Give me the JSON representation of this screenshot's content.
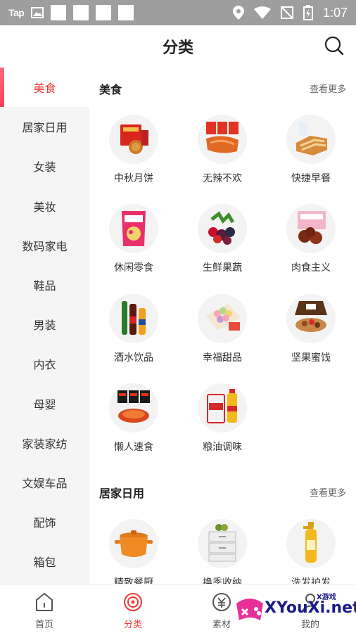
{
  "status_bar": {
    "app_label": "Tap",
    "time": "1:07"
  },
  "header": {
    "title": "分类"
  },
  "sidebar": {
    "items": [
      {
        "label": "美食"
      },
      {
        "label": "居家日用"
      },
      {
        "label": "女装"
      },
      {
        "label": "美妆"
      },
      {
        "label": "数码家电"
      },
      {
        "label": "鞋品"
      },
      {
        "label": "男装"
      },
      {
        "label": "内衣"
      },
      {
        "label": "母婴"
      },
      {
        "label": "家装家纺"
      },
      {
        "label": "文娱车品"
      },
      {
        "label": "配饰"
      },
      {
        "label": "箱包"
      }
    ],
    "active_index": 0
  },
  "sections": [
    {
      "title": "美食",
      "more": "查看更多",
      "items": [
        {
          "label": "中秋月饼",
          "icon": "mooncake-icon"
        },
        {
          "label": "无辣不欢",
          "icon": "spicy-snack-icon"
        },
        {
          "label": "快捷早餐",
          "icon": "bread-icon"
        },
        {
          "label": "休闲零食",
          "icon": "snack-bag-icon"
        },
        {
          "label": "生鲜果蔬",
          "icon": "berries-icon"
        },
        {
          "label": "肉食主义",
          "icon": "meat-box-icon"
        },
        {
          "label": "酒水饮品",
          "icon": "bottles-icon"
        },
        {
          "label": "幸福甜品",
          "icon": "macaron-icon"
        },
        {
          "label": "坚果蜜饯",
          "icon": "nuts-box-icon"
        },
        {
          "label": "懒人速食",
          "icon": "instant-noodle-icon"
        },
        {
          "label": "粮油调味",
          "icon": "rice-oil-icon"
        }
      ]
    },
    {
      "title": "居家日用",
      "more": "查看更多",
      "items": [
        {
          "label": "精致餐厨",
          "icon": "pot-icon"
        },
        {
          "label": "换季收纳",
          "icon": "storage-drawer-icon"
        },
        {
          "label": "洗发护发",
          "icon": "shampoo-icon"
        }
      ]
    }
  ],
  "bottom_nav": [
    {
      "label": "首页",
      "icon": "home-icon"
    },
    {
      "label": "分类",
      "icon": "category-icon"
    },
    {
      "label": "素材",
      "icon": "material-icon"
    },
    {
      "label": "我的",
      "icon": "profile-icon"
    }
  ],
  "watermark": {
    "text": "XYouXi.net",
    "small": "X游戏"
  },
  "colors": {
    "accent": "#ee3a32",
    "sidebar_bg": "#f5f5f5",
    "status_bar": "#9e9e9e"
  }
}
